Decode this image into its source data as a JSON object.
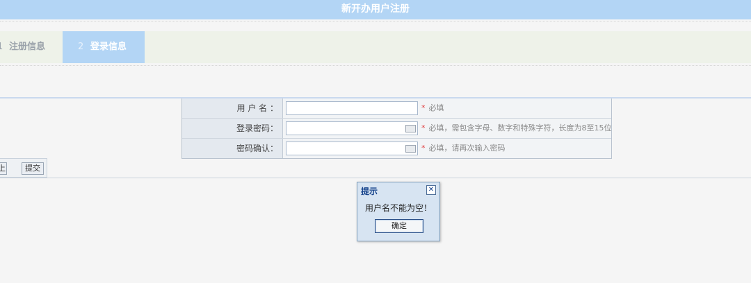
{
  "header": {
    "title": "新开办用户注册"
  },
  "steps": [
    {
      "num": "1",
      "label": "注册信息",
      "active": false
    },
    {
      "num": "2",
      "label": "登录信息",
      "active": true
    }
  ],
  "form": {
    "rows": [
      {
        "label": "用 户 名 ：",
        "value": "",
        "hint": "必填",
        "required": "*",
        "icon": ""
      },
      {
        "label": "登录密码：",
        "value": "",
        "hint": "必填，需包含字母、数字和特殊字符，长度为8至15位",
        "required": "*",
        "icon": "keyboard-icon"
      },
      {
        "label": "密码确认：",
        "value": "",
        "hint": "必填，请再次输入密码",
        "required": "*",
        "icon": "keyboard-icon"
      }
    ]
  },
  "buttons": {
    "prev_label": "上一步",
    "submit_label": "提交"
  },
  "dialog": {
    "title": "提示",
    "close": "✕",
    "message": "用户名不能为空！",
    "ok_label": "确定"
  }
}
